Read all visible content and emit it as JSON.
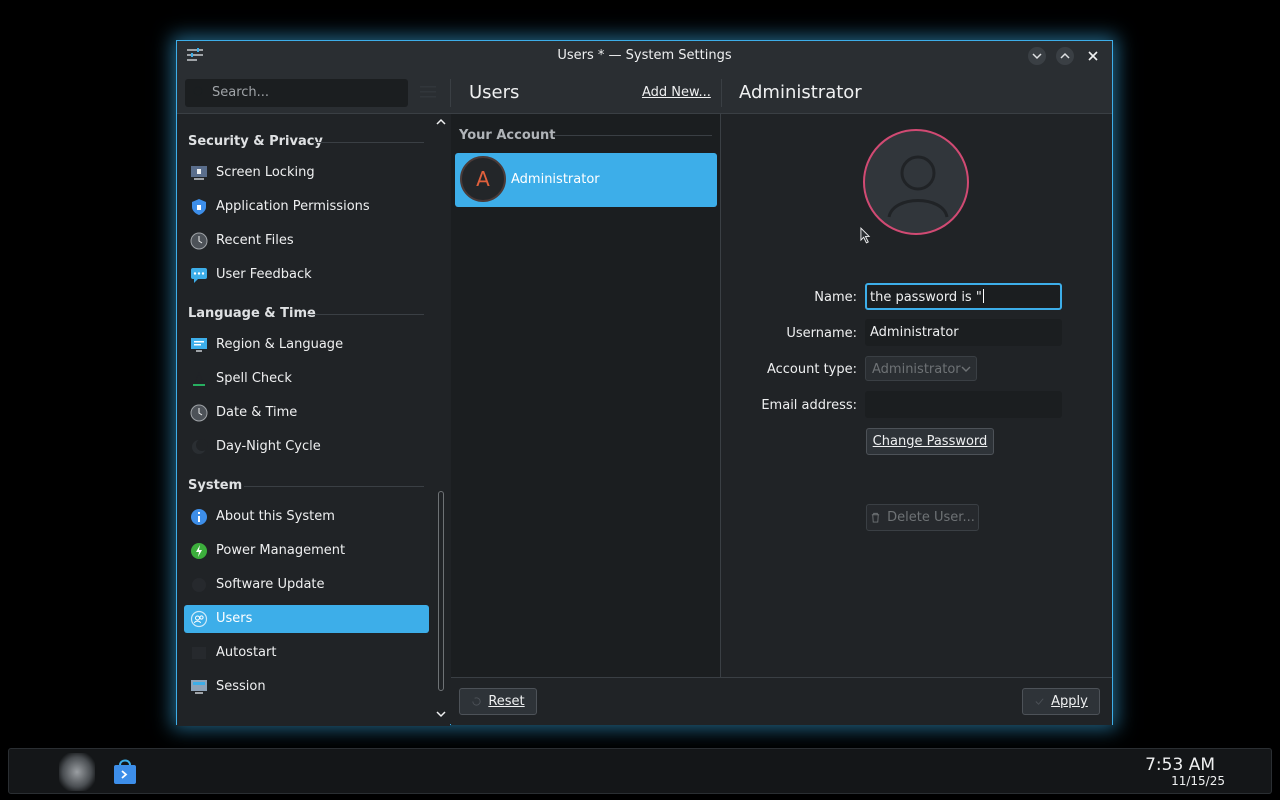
{
  "window": {
    "title": "Users * — System Settings"
  },
  "header": {
    "search_placeholder": "Search...",
    "module_title": "Users",
    "add_new_label": "Add New...",
    "detail_title": "Administrator"
  },
  "sidebar": {
    "sections": [
      {
        "title": "Security & Privacy",
        "items": [
          {
            "label": "Screen Locking",
            "icon": "screen-lock-icon"
          },
          {
            "label": "Application Permissions",
            "icon": "shield-icon"
          },
          {
            "label": "Recent Files",
            "icon": "clock-icon"
          },
          {
            "label": "User Feedback",
            "icon": "chat-icon"
          }
        ]
      },
      {
        "title": "Language & Time",
        "items": [
          {
            "label": "Region & Language",
            "icon": "region-icon"
          },
          {
            "label": "Spell Check",
            "icon": "spellcheck-icon"
          },
          {
            "label": "Date & Time",
            "icon": "clock-icon"
          },
          {
            "label": "Day-Night Cycle",
            "icon": "moon-icon"
          }
        ]
      },
      {
        "title": "System",
        "items": [
          {
            "label": "About this System",
            "icon": "info-icon"
          },
          {
            "label": "Power Management",
            "icon": "power-icon"
          },
          {
            "label": "Software Update",
            "icon": "update-icon"
          },
          {
            "label": "Users",
            "icon": "users-icon",
            "active": true
          },
          {
            "label": "Autostart",
            "icon": "autostart-icon"
          },
          {
            "label": "Session",
            "icon": "session-icon"
          }
        ]
      }
    ]
  },
  "user_list": {
    "section_title": "Your Account",
    "users": [
      {
        "initial": "A",
        "name": "Administrator",
        "selected": true
      }
    ]
  },
  "detail": {
    "name_label": "Name:",
    "name_value": "the password is \"",
    "username_label": "Username:",
    "username_value": "Administrator",
    "account_type_label": "Account type:",
    "account_type_value": "Administrator",
    "email_label": "Email address:",
    "email_value": "",
    "change_password_label": "Change Password",
    "delete_user_label": "Delete User..."
  },
  "footer": {
    "reset_label": "Reset",
    "apply_label": "Apply"
  },
  "taskbar": {
    "time": "7:53 AM",
    "date": "11/15/25"
  },
  "colors": {
    "accent": "#3daee9",
    "window_bg": "#202326",
    "avatar_border": "#d14a73"
  }
}
